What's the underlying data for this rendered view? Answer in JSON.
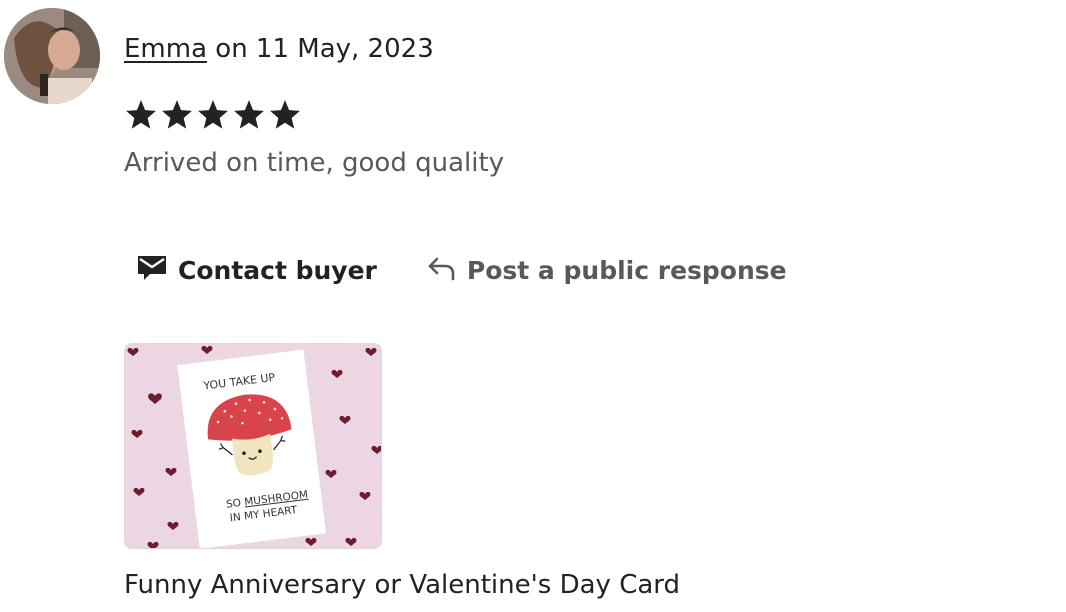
{
  "review": {
    "reviewer_name": "Emma",
    "date_text": "on 11 May, 2023",
    "rating": 5,
    "rating_max": 5,
    "text": "Arrived on time, good quality"
  },
  "actions": {
    "contact_label": "Contact buyer",
    "respond_label": "Post a public response"
  },
  "product": {
    "title": "Funny Anniversary or Valentine's Day Card",
    "card_text_top": "YOU TAKE UP",
    "card_text_line2_prefix": "SO ",
    "card_text_line2_emph": "MUSHROOM",
    "card_text_line3": "IN MY HEART"
  },
  "colors": {
    "text_primary": "#222222",
    "text_secondary": "#595959",
    "thumb_background": "#ecd6e4",
    "mushroom_cap": "#d9434a"
  },
  "icons": {
    "contact": "envelope-icon",
    "respond": "reply-arrow-icon",
    "rating": "star-icon"
  }
}
